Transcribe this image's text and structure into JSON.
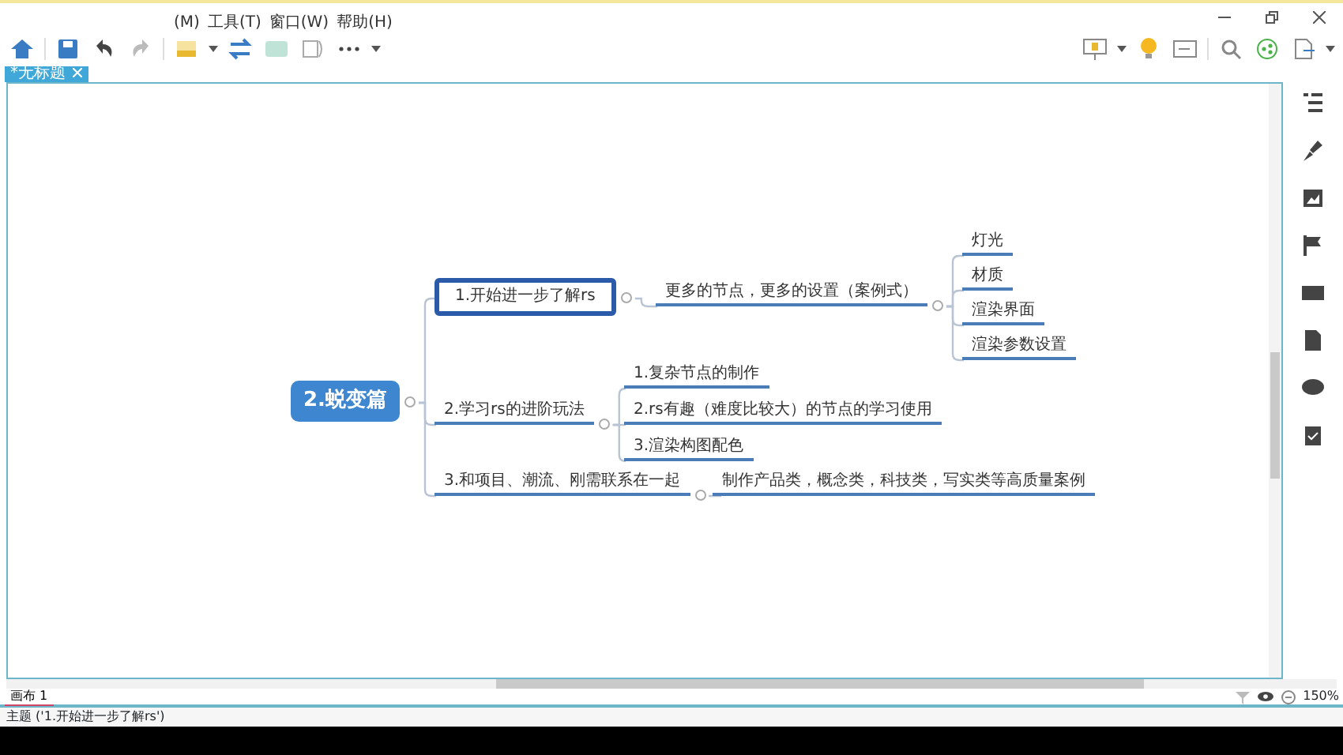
{
  "menu": [
    "(M)",
    "工具(T)",
    "窗口(W)",
    "帮助(H)"
  ],
  "tabs": [
    {
      "label": "*无标题",
      "selected": true
    }
  ],
  "mind_map": {
    "text": "2.蜕变篇",
    "selected": false,
    "children": [
      {
        "text": "1.开始进一步了解rs",
        "selected": true,
        "children": [
          {
            "text": "更多的节点，更多的设置（案例式）",
            "selected": false,
            "children": [
              {
                "text": "灯光",
                "selected": false
              },
              {
                "text": "材质",
                "selected": false
              },
              {
                "text": "渲染界面",
                "selected": false
              },
              {
                "text": "渲染参数设置",
                "selected": false
              }
            ]
          }
        ]
      },
      {
        "text": "2.学习rs的进阶玩法",
        "selected": false,
        "children": [
          {
            "text": "1.复杂节点的制作",
            "selected": false
          },
          {
            "text": "2.rs有趣（难度比较大）的节点的学习使用",
            "selected": false
          },
          {
            "text": "3.渲染构图配色",
            "selected": false
          }
        ]
      },
      {
        "text": "3.和项目、潮流、刚需联系在一起",
        "selected": false,
        "children": [
          {
            "text": "制作产品类，概念类，科技类，写实类等高质量案例",
            "selected": false
          }
        ]
      }
    ]
  },
  "sheet_tabs": [
    {
      "label": "画布 1",
      "selected": true
    }
  ],
  "zoom": "150%",
  "status_bar": "主题 ('1.开始进一步了解rs')"
}
